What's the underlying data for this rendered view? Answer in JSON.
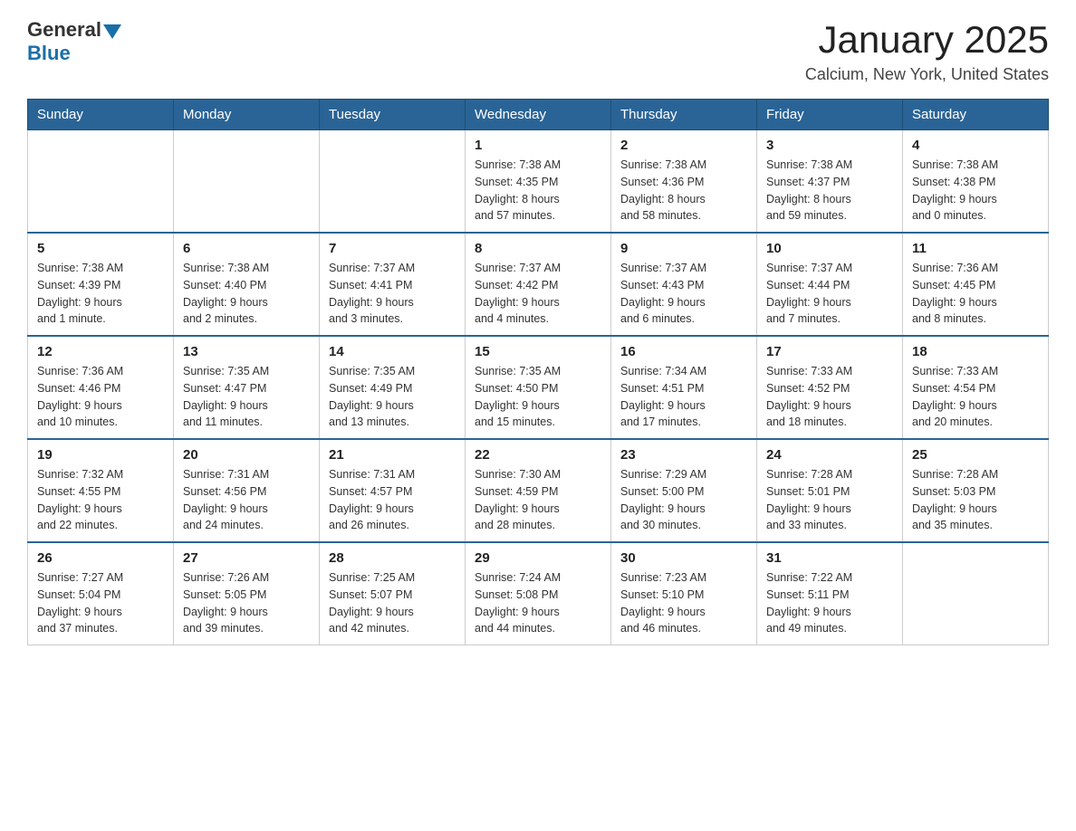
{
  "header": {
    "logo_general": "General",
    "logo_blue": "Blue",
    "month_year": "January 2025",
    "location": "Calcium, New York, United States"
  },
  "days_of_week": [
    "Sunday",
    "Monday",
    "Tuesday",
    "Wednesday",
    "Thursday",
    "Friday",
    "Saturday"
  ],
  "weeks": [
    [
      {
        "day": "",
        "info": ""
      },
      {
        "day": "",
        "info": ""
      },
      {
        "day": "",
        "info": ""
      },
      {
        "day": "1",
        "info": "Sunrise: 7:38 AM\nSunset: 4:35 PM\nDaylight: 8 hours\nand 57 minutes."
      },
      {
        "day": "2",
        "info": "Sunrise: 7:38 AM\nSunset: 4:36 PM\nDaylight: 8 hours\nand 58 minutes."
      },
      {
        "day": "3",
        "info": "Sunrise: 7:38 AM\nSunset: 4:37 PM\nDaylight: 8 hours\nand 59 minutes."
      },
      {
        "day": "4",
        "info": "Sunrise: 7:38 AM\nSunset: 4:38 PM\nDaylight: 9 hours\nand 0 minutes."
      }
    ],
    [
      {
        "day": "5",
        "info": "Sunrise: 7:38 AM\nSunset: 4:39 PM\nDaylight: 9 hours\nand 1 minute."
      },
      {
        "day": "6",
        "info": "Sunrise: 7:38 AM\nSunset: 4:40 PM\nDaylight: 9 hours\nand 2 minutes."
      },
      {
        "day": "7",
        "info": "Sunrise: 7:37 AM\nSunset: 4:41 PM\nDaylight: 9 hours\nand 3 minutes."
      },
      {
        "day": "8",
        "info": "Sunrise: 7:37 AM\nSunset: 4:42 PM\nDaylight: 9 hours\nand 4 minutes."
      },
      {
        "day": "9",
        "info": "Sunrise: 7:37 AM\nSunset: 4:43 PM\nDaylight: 9 hours\nand 6 minutes."
      },
      {
        "day": "10",
        "info": "Sunrise: 7:37 AM\nSunset: 4:44 PM\nDaylight: 9 hours\nand 7 minutes."
      },
      {
        "day": "11",
        "info": "Sunrise: 7:36 AM\nSunset: 4:45 PM\nDaylight: 9 hours\nand 8 minutes."
      }
    ],
    [
      {
        "day": "12",
        "info": "Sunrise: 7:36 AM\nSunset: 4:46 PM\nDaylight: 9 hours\nand 10 minutes."
      },
      {
        "day": "13",
        "info": "Sunrise: 7:35 AM\nSunset: 4:47 PM\nDaylight: 9 hours\nand 11 minutes."
      },
      {
        "day": "14",
        "info": "Sunrise: 7:35 AM\nSunset: 4:49 PM\nDaylight: 9 hours\nand 13 minutes."
      },
      {
        "day": "15",
        "info": "Sunrise: 7:35 AM\nSunset: 4:50 PM\nDaylight: 9 hours\nand 15 minutes."
      },
      {
        "day": "16",
        "info": "Sunrise: 7:34 AM\nSunset: 4:51 PM\nDaylight: 9 hours\nand 17 minutes."
      },
      {
        "day": "17",
        "info": "Sunrise: 7:33 AM\nSunset: 4:52 PM\nDaylight: 9 hours\nand 18 minutes."
      },
      {
        "day": "18",
        "info": "Sunrise: 7:33 AM\nSunset: 4:54 PM\nDaylight: 9 hours\nand 20 minutes."
      }
    ],
    [
      {
        "day": "19",
        "info": "Sunrise: 7:32 AM\nSunset: 4:55 PM\nDaylight: 9 hours\nand 22 minutes."
      },
      {
        "day": "20",
        "info": "Sunrise: 7:31 AM\nSunset: 4:56 PM\nDaylight: 9 hours\nand 24 minutes."
      },
      {
        "day": "21",
        "info": "Sunrise: 7:31 AM\nSunset: 4:57 PM\nDaylight: 9 hours\nand 26 minutes."
      },
      {
        "day": "22",
        "info": "Sunrise: 7:30 AM\nSunset: 4:59 PM\nDaylight: 9 hours\nand 28 minutes."
      },
      {
        "day": "23",
        "info": "Sunrise: 7:29 AM\nSunset: 5:00 PM\nDaylight: 9 hours\nand 30 minutes."
      },
      {
        "day": "24",
        "info": "Sunrise: 7:28 AM\nSunset: 5:01 PM\nDaylight: 9 hours\nand 33 minutes."
      },
      {
        "day": "25",
        "info": "Sunrise: 7:28 AM\nSunset: 5:03 PM\nDaylight: 9 hours\nand 35 minutes."
      }
    ],
    [
      {
        "day": "26",
        "info": "Sunrise: 7:27 AM\nSunset: 5:04 PM\nDaylight: 9 hours\nand 37 minutes."
      },
      {
        "day": "27",
        "info": "Sunrise: 7:26 AM\nSunset: 5:05 PM\nDaylight: 9 hours\nand 39 minutes."
      },
      {
        "day": "28",
        "info": "Sunrise: 7:25 AM\nSunset: 5:07 PM\nDaylight: 9 hours\nand 42 minutes."
      },
      {
        "day": "29",
        "info": "Sunrise: 7:24 AM\nSunset: 5:08 PM\nDaylight: 9 hours\nand 44 minutes."
      },
      {
        "day": "30",
        "info": "Sunrise: 7:23 AM\nSunset: 5:10 PM\nDaylight: 9 hours\nand 46 minutes."
      },
      {
        "day": "31",
        "info": "Sunrise: 7:22 AM\nSunset: 5:11 PM\nDaylight: 9 hours\nand 49 minutes."
      },
      {
        "day": "",
        "info": ""
      }
    ]
  ]
}
